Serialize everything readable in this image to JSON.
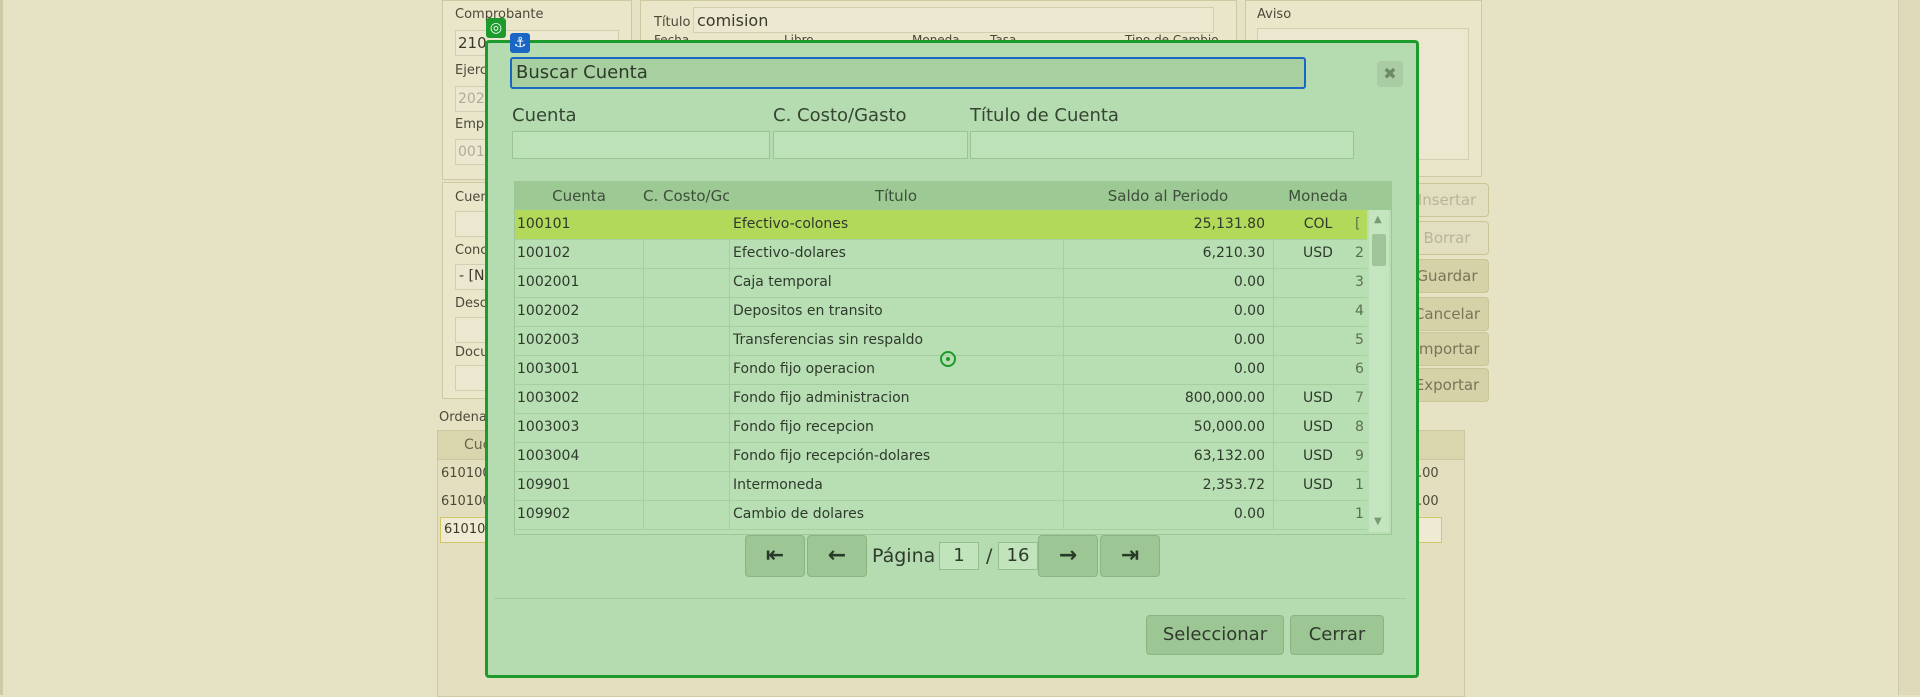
{
  "background": {
    "labels": {
      "comprobante": "Comprobante",
      "comprobante_value": "210",
      "ejercicio": "Ejerc",
      "ejercicio_value": "202",
      "empresa": "Empr",
      "empresa_value": "001",
      "titulo": "Título",
      "titulo_value": "comision",
      "fecha": "Fecha",
      "libro": "Libro",
      "moneda": "Moneda",
      "tasa": "Tasa",
      "tipo_cambio": "Tipo de Cambio",
      "aviso": "Aviso",
      "cuenta": "Cuen",
      "concepto": "Conc",
      "concepto_value": "- [N",
      "descripcion": "Desc",
      "documento": "Docu",
      "ordenar": "Ordena",
      "table_col": "Cue",
      "rows": [
        "610100",
        "610100",
        "610100"
      ],
      "right_values": [
        ".00",
        ".00"
      ]
    },
    "buttons": {
      "insertar": "Insertar",
      "borrar": "Borrar",
      "guardar": "Guardar",
      "cancelar": "Cancelar",
      "importar": "Importar",
      "exportar": "Exportar"
    }
  },
  "modal": {
    "title": "Buscar Cuenta",
    "filters": {
      "cuenta_label": "Cuenta",
      "costo_label": "C. Costo/Gasto",
      "titulo_label": "Título de Cuenta"
    },
    "grid": {
      "headers": [
        "Cuenta",
        "C. Costo/Gc",
        "Título",
        "Saldo al Periodo",
        "Moneda"
      ],
      "rows": [
        {
          "cuenta": "100101",
          "costo": "",
          "titulo": "Efectivo-colones",
          "saldo": "25,131.80",
          "moneda": "COL",
          "tail": "["
        },
        {
          "cuenta": "100102",
          "costo": "",
          "titulo": "Efectivo-dolares",
          "saldo": "6,210.30",
          "moneda": "USD",
          "tail": "2"
        },
        {
          "cuenta": "1002001",
          "costo": "",
          "titulo": "Caja temporal",
          "saldo": "0.00",
          "moneda": "",
          "tail": "3"
        },
        {
          "cuenta": "1002002",
          "costo": "",
          "titulo": "Depositos en transito",
          "saldo": "0.00",
          "moneda": "",
          "tail": "4"
        },
        {
          "cuenta": "1002003",
          "costo": "",
          "titulo": "Transferencias sin respaldo",
          "saldo": "0.00",
          "moneda": "",
          "tail": "5"
        },
        {
          "cuenta": "1003001",
          "costo": "",
          "titulo": "Fondo fijo operacion",
          "saldo": "0.00",
          "moneda": "",
          "tail": "6"
        },
        {
          "cuenta": "1003002",
          "costo": "",
          "titulo": "Fondo fijo administracion",
          "saldo": "800,000.00",
          "moneda": "USD",
          "tail": "7"
        },
        {
          "cuenta": "1003003",
          "costo": "",
          "titulo": "Fondo fijo recepcion",
          "saldo": "50,000.00",
          "moneda": "USD",
          "tail": "8"
        },
        {
          "cuenta": "1003004",
          "costo": "",
          "titulo": "Fondo fijo recepción-dolares",
          "saldo": "63,132.00",
          "moneda": "USD",
          "tail": "9"
        },
        {
          "cuenta": "109901",
          "costo": "",
          "titulo": "Intermoneda",
          "saldo": "2,353.72",
          "moneda": "USD",
          "tail": "1"
        },
        {
          "cuenta": "109902",
          "costo": "",
          "titulo": "Cambio de dolares",
          "saldo": "0.00",
          "moneda": "",
          "tail": "1"
        }
      ]
    },
    "pager": {
      "label": "Página",
      "current": "1",
      "separator": "/",
      "total": "16"
    },
    "actions": {
      "select": "Seleccionar",
      "close": "Cerrar"
    }
  }
}
